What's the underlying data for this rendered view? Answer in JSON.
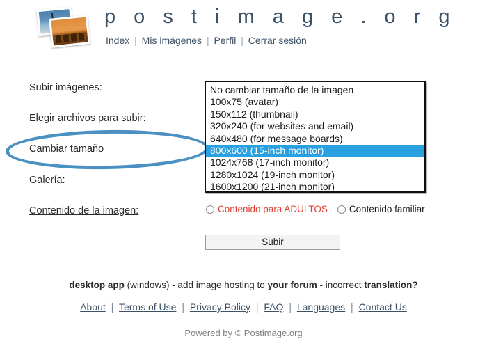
{
  "header": {
    "logo_icon": "stacked-photos-icon",
    "site_title": "p o s t i m a g e . o r g",
    "nav": [
      {
        "label": "Index"
      },
      {
        "label": "Mis imágenes"
      },
      {
        "label": "Perfil"
      },
      {
        "label": "Cerrar sesión"
      }
    ],
    "nav_separator": "|"
  },
  "form": {
    "labels": {
      "upload_images": "Subir imágenes:",
      "choose_files": "Elegir archivos para subir:",
      "resize": "Cambiar tamaño",
      "gallery": "Galería:",
      "image_content": "Contenido de la imagen:"
    },
    "size_listbox": {
      "selected_value": "800x600 (15-inch monitor)",
      "options": [
        "No cambiar tamaño de la imagen",
        "100x75 (avatar)",
        "150x112 (thumbnail)",
        "320x240 (for websites and email)",
        "640x480 (for message boards)",
        "800x600 (15-inch monitor)",
        "1024x768 (17-inch monitor)",
        "1280x1024 (19-inch monitor)",
        "1600x1200 (21-inch monitor)"
      ],
      "selected_index": 5
    },
    "content_radios": [
      {
        "label": "Contenido para ADULTOS",
        "checked": false,
        "color": "#e04030"
      },
      {
        "label": "Contenido familiar",
        "checked": false,
        "color": "#1a1a1a"
      }
    ],
    "submit_label": "Subir"
  },
  "annotation": {
    "shape": "ellipse",
    "color": "#4a90c2",
    "targets_label": "Cambiar tamaño"
  },
  "footer": {
    "line1": {
      "desktop_app": "desktop app",
      "windows": " (windows) - add image hosting to ",
      "your_forum": "your forum",
      "incorrect": " - incorrect ",
      "translation": "translation?"
    },
    "links": [
      {
        "label": "About"
      },
      {
        "label": "Terms of Use"
      },
      {
        "label": "Privacy Policy"
      },
      {
        "label": "FAQ"
      },
      {
        "label": "Languages"
      },
      {
        "label": "Contact Us"
      }
    ],
    "link_separator": "|",
    "powered_by": "Powered by © Postimage.org"
  },
  "colors": {
    "title": "#3d5166",
    "highlight": "#29a0e0",
    "annotation": "#4a90c2",
    "adult_red": "#e04030",
    "rule": "#c9c9c9"
  }
}
